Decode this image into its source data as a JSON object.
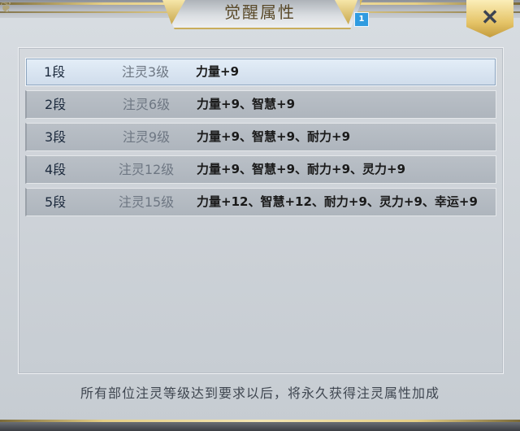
{
  "window": {
    "title": "觉醒属性",
    "badge": "1",
    "close_label": "✕"
  },
  "table": {
    "rows": [
      {
        "stage": "1段",
        "level": "注灵3级",
        "attr": "力量+9",
        "selected": true
      },
      {
        "stage": "2段",
        "level": "注灵6级",
        "attr": "力量+9、智慧+9",
        "selected": false
      },
      {
        "stage": "3段",
        "level": "注灵9级",
        "attr": "力量+9、智慧+9、耐力+9",
        "selected": false
      },
      {
        "stage": "4段",
        "level": "注灵12级",
        "attr": "力量+9、智慧+9、耐力+9、灵力+9",
        "selected": false
      },
      {
        "stage": "5段",
        "level": "注灵15级",
        "attr": "力量+12、智慧+12、耐力+9、灵力+9、幸运+9",
        "selected": false
      }
    ]
  },
  "footer": {
    "text": "所有部位注灵等级达到要求以后，将永久获得注灵属性加成"
  }
}
